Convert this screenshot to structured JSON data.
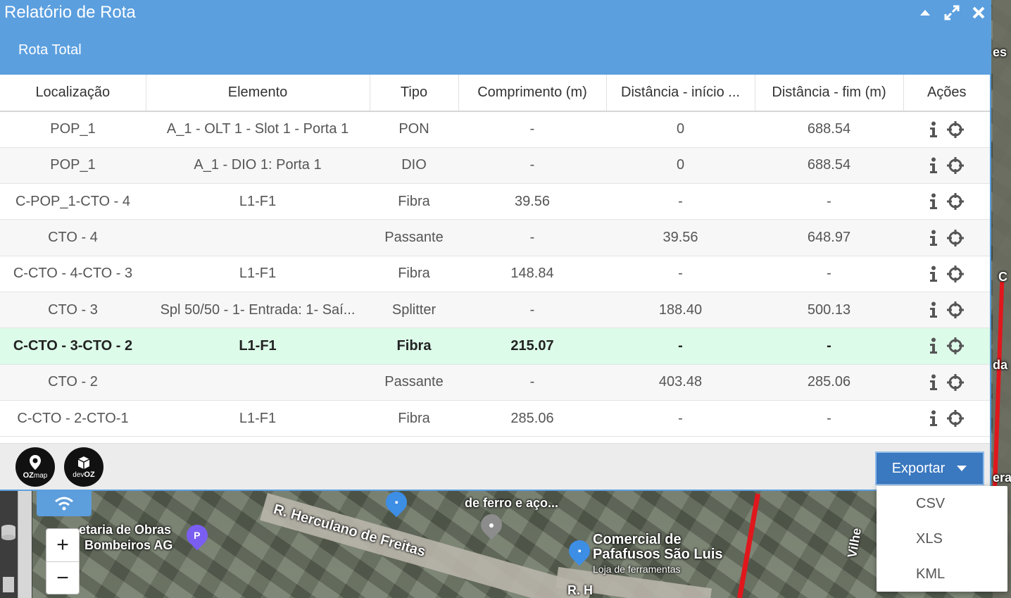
{
  "window": {
    "title": "Relatório de Rota",
    "tab": "Rota Total"
  },
  "table": {
    "headers": [
      "Localização",
      "Elemento",
      "Tipo",
      "Comprimento (m)",
      "Distância - início ...",
      "Distância - fim (m)",
      "Ações"
    ],
    "rows": [
      [
        "POP_1",
        "A_1 - OLT 1 - Slot 1 - Porta 1",
        "PON",
        "-",
        "0",
        "688.54"
      ],
      [
        "POP_1",
        "A_1 - DIO 1: Porta 1",
        "DIO",
        "-",
        "0",
        "688.54"
      ],
      [
        "C-POP_1-CTO - 4",
        "L1-F1",
        "Fibra",
        "39.56",
        "-",
        "-"
      ],
      [
        "CTO - 4",
        "",
        "Passante",
        "-",
        "39.56",
        "648.97"
      ],
      [
        "C-CTO - 4-CTO - 3",
        "L1-F1",
        "Fibra",
        "148.84",
        "-",
        "-"
      ],
      [
        "CTO - 3",
        "Spl 50/50 - 1- Entrada: 1- Saí...",
        "Splitter",
        "-",
        "188.40",
        "500.13"
      ],
      [
        "C-CTO - 3-CTO - 2",
        "L1-F1",
        "Fibra",
        "215.07",
        "-",
        "-"
      ],
      [
        "CTO - 2",
        "",
        "Passante",
        "-",
        "403.48",
        "285.06"
      ],
      [
        "C-CTO - 2-CTO-1",
        "L1-F1",
        "Fibra",
        "285.06",
        "-",
        "-"
      ]
    ]
  },
  "footer": {
    "logo1": {
      "main": "OZ",
      "sub": "map"
    },
    "logo2": {
      "main": "OZ",
      "sub": "dev"
    },
    "export_label": "Exportar",
    "export_options": [
      "CSV",
      "XLS",
      "KML"
    ]
  },
  "map": {
    "labels": [
      "R. Herculano de Freitas",
      "Comercial de",
      "Pafafusos São Luis",
      "Loja de ferramentas",
      "de ferro e aço...",
      "etaria de Obras",
      "Bombeiros AG",
      "Vilhe",
      "es",
      "C",
      "da",
      "era",
      "R. H"
    ],
    "zoom_in": "+",
    "zoom_out": "−",
    "pin_p": "P"
  }
}
